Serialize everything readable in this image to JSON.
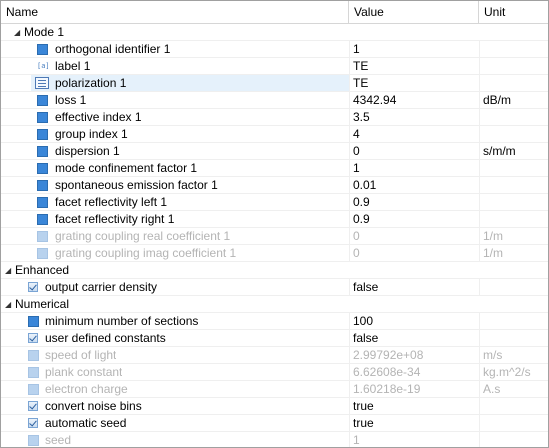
{
  "header": {
    "name": "Name",
    "value": "Value",
    "unit": "Unit"
  },
  "groups": {
    "mode": "Mode 1",
    "enhanced": "Enhanced",
    "numerical": "Numerical"
  },
  "rows": [
    {
      "name": "orthogonal identifier 1",
      "value": "1",
      "unit": "",
      "icon": "blue-square-icon",
      "disabled": false
    },
    {
      "name": "label 1",
      "value": "TE",
      "unit": "",
      "icon": "label-icon",
      "disabled": false
    },
    {
      "name": "polarization 1",
      "value": "TE",
      "unit": "",
      "icon": "polarization-icon",
      "disabled": false,
      "selected": true
    },
    {
      "name": "loss 1",
      "value": "4342.94",
      "unit": "dB/m",
      "icon": "blue-square-icon",
      "disabled": false
    },
    {
      "name": "effective index 1",
      "value": "3.5",
      "unit": "",
      "icon": "blue-square-icon",
      "disabled": false
    },
    {
      "name": "group index 1",
      "value": "4",
      "unit": "",
      "icon": "blue-square-icon",
      "disabled": false
    },
    {
      "name": "dispersion 1",
      "value": "0",
      "unit": "s/m/m",
      "icon": "blue-square-icon",
      "disabled": false
    },
    {
      "name": "mode confinement factor 1",
      "value": "1",
      "unit": "",
      "icon": "blue-square-icon",
      "disabled": false
    },
    {
      "name": "spontaneous emission factor 1",
      "value": "0.01",
      "unit": "",
      "icon": "blue-square-icon",
      "disabled": false
    },
    {
      "name": "facet reflectivity left 1",
      "value": "0.9",
      "unit": "",
      "icon": "blue-square-icon",
      "disabled": false
    },
    {
      "name": "facet reflectivity right 1",
      "value": "0.9",
      "unit": "",
      "icon": "blue-square-icon",
      "disabled": false
    },
    {
      "name": "grating coupling real coefficient 1",
      "value": "0",
      "unit": "1/m",
      "icon": "blue-square-icon",
      "disabled": true
    },
    {
      "name": "grating coupling imag coefficient 1",
      "value": "0",
      "unit": "1/m",
      "icon": "blue-square-icon",
      "disabled": true
    },
    {
      "name": "output carrier density",
      "value": "false",
      "unit": "",
      "icon": "checkbox-icon",
      "disabled": false
    },
    {
      "name": "minimum number of sections",
      "value": "100",
      "unit": "",
      "icon": "blue-square-icon",
      "disabled": false
    },
    {
      "name": "user defined constants",
      "value": "false",
      "unit": "",
      "icon": "checkbox-icon",
      "disabled": false
    },
    {
      "name": "speed of light",
      "value": "2.99792e+08",
      "unit": "m/s",
      "icon": "blue-square-icon",
      "disabled": true
    },
    {
      "name": "plank constant",
      "value": "6.62608e-34",
      "unit": "kg.m^2/s",
      "icon": "blue-square-icon",
      "disabled": true
    },
    {
      "name": "electron charge",
      "value": "1.60218e-19",
      "unit": "A.s",
      "icon": "blue-square-icon",
      "disabled": true
    },
    {
      "name": "convert noise bins",
      "value": "true",
      "unit": "",
      "icon": "checkbox-icon",
      "disabled": false
    },
    {
      "name": "automatic seed",
      "value": "true",
      "unit": "",
      "icon": "checkbox-icon",
      "disabled": false
    },
    {
      "name": "seed",
      "value": "1",
      "unit": "",
      "icon": "blue-square-icon",
      "disabled": true
    }
  ]
}
